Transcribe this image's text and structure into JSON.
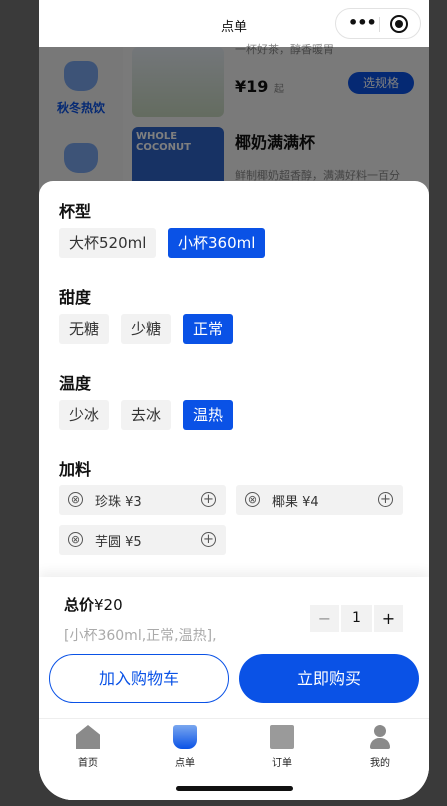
{
  "navbar": {
    "title": "点单"
  },
  "background": {
    "category_label": "秋冬热饮",
    "product1": {
      "desc": "一杯好茶，醇香暖胃",
      "price": "¥19",
      "price_suffix": "起",
      "spec_button": "选规格"
    },
    "product2": {
      "image_text": "WHOLE COCONUT",
      "name": "椰奶满满杯",
      "desc": "鲜制椰奶超香醇，满满好料一百分"
    }
  },
  "sheet": {
    "cup": {
      "title": "杯型",
      "options": [
        "大杯520ml",
        "小杯360ml"
      ],
      "selected": "小杯360ml"
    },
    "sweet": {
      "title": "甜度",
      "options": [
        "无糖",
        "少糖",
        "正常"
      ],
      "selected": "正常"
    },
    "temp": {
      "title": "温度",
      "options": [
        "少冰",
        "去冰",
        "温热"
      ],
      "selected": "温热"
    },
    "toppings": {
      "title": "加料",
      "items": [
        {
          "name": "珍珠 ¥3"
        },
        {
          "name": "椰果 ¥4"
        },
        {
          "name": "芋圆 ¥5"
        }
      ],
      "minus_glyph": "⊗",
      "plus_glyph": "+"
    }
  },
  "footer": {
    "total_label": "总价",
    "total_value": "¥20",
    "summary": "[小杯360ml,正常,温热],",
    "quantity": "1",
    "minus": "−",
    "plus": "+",
    "add_to_cart": "加入购物车",
    "buy_now": "立即购买"
  },
  "tabbar": {
    "items": [
      {
        "label": "首页",
        "icon": "home-icon"
      },
      {
        "label": "点单",
        "icon": "cup-icon"
      },
      {
        "label": "订单",
        "icon": "order-icon"
      },
      {
        "label": "我的",
        "icon": "user-icon"
      }
    ]
  },
  "colors": {
    "accent": "#0a52e6",
    "chip": "#f2f2f2"
  }
}
